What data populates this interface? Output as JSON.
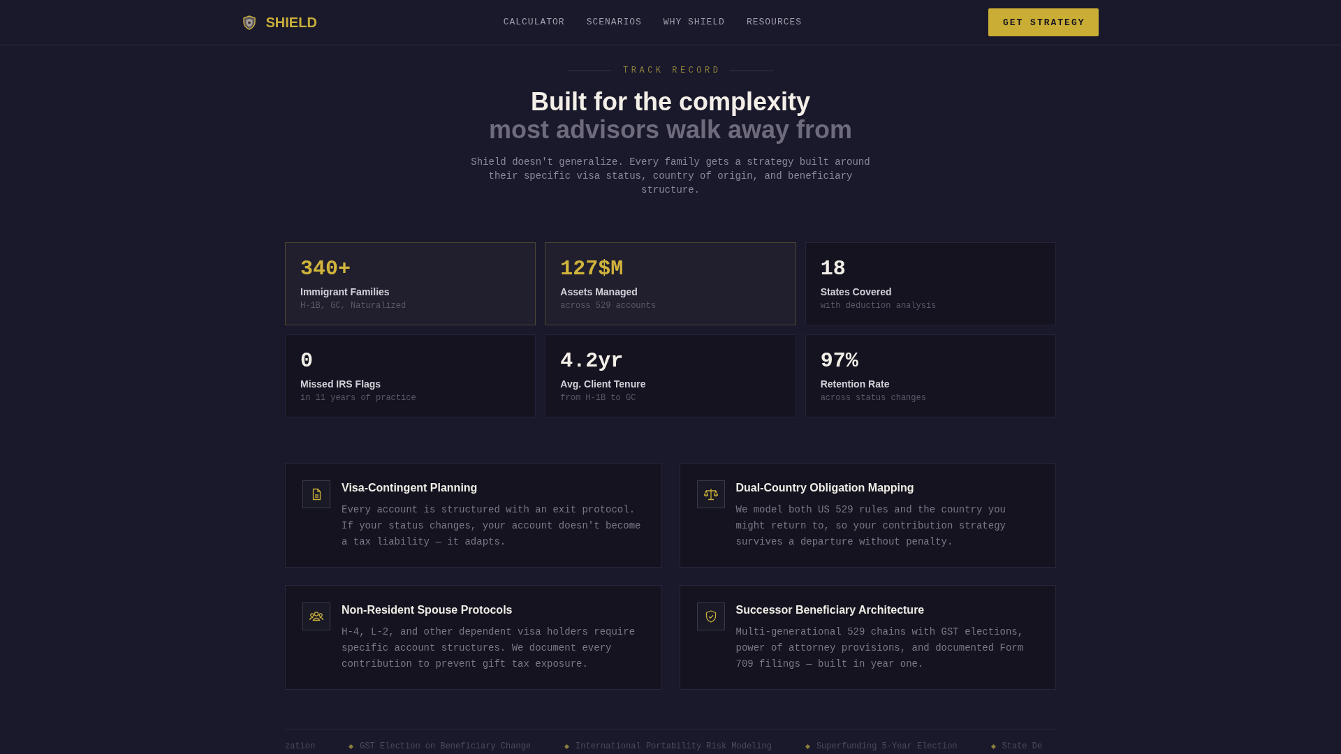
{
  "nav": {
    "brand": "SHIELD",
    "links": [
      "CALCULATOR",
      "SCENARIOS",
      "WHY SHIELD",
      "RESOURCES"
    ],
    "cta": "GET STRATEGY"
  },
  "hero": {
    "eyebrow": "TRACK RECORD",
    "title": "Built for the complexity",
    "title_muted": "most advisors walk away from",
    "description": "Shield doesn't generalize. Every family gets a strategy built around their specific visa status, country of origin, and beneficiary structure."
  },
  "stats": [
    {
      "value": "340+",
      "label": "Immigrant Families",
      "detail": "H-1B, GC, Naturalized",
      "highlighted": true
    },
    {
      "value": "127$M",
      "label": "Assets Managed",
      "detail": "across 529 accounts",
      "highlighted": true
    },
    {
      "value": "18",
      "label": "States Covered",
      "detail": "with deduction analysis",
      "highlighted": false
    },
    {
      "value": "0",
      "label": "Missed IRS Flags",
      "detail": "in 11 years of practice",
      "highlighted": false
    },
    {
      "value": "4.2yr",
      "label": "Avg. Client Tenure",
      "detail": "from H-1B to GC",
      "highlighted": false
    },
    {
      "value": "97%",
      "label": "Retention Rate",
      "detail": "across status changes",
      "highlighted": false
    }
  ],
  "features": [
    {
      "kind": "document",
      "title": "Visa-Contingent Planning",
      "description": "Every account is structured with an exit protocol. If your status changes, your account doesn't become a tax liability — it adapts."
    },
    {
      "kind": "scales",
      "title": "Dual-Country Obligation Mapping",
      "description": "We model both US 529 rules and the country you might return to, so your contribution strategy survives a departure without penalty."
    },
    {
      "kind": "people",
      "title": "Non-Resident Spouse Protocols",
      "description": "H-4, L-2, and other dependent visa holders require specific account structures. We document every contribution to prevent gift tax exposure."
    },
    {
      "kind": "shield",
      "title": "Successor Beneficiary Architecture",
      "description": "Multi-generational 529 chains with GST elections, power of attorney provisions, and documented Form 709 filings — built in year one."
    }
  ],
  "ticker": [
    {
      "text": "zation",
      "marker": false
    },
    {
      "text": "GST Election on Beneficiary Change",
      "marker": true
    },
    {
      "text": "International Portability Risk Modeling",
      "marker": true
    },
    {
      "text": "Superfunding 5-Year Election",
      "marker": true
    },
    {
      "text": "State De",
      "marker": true
    }
  ]
}
